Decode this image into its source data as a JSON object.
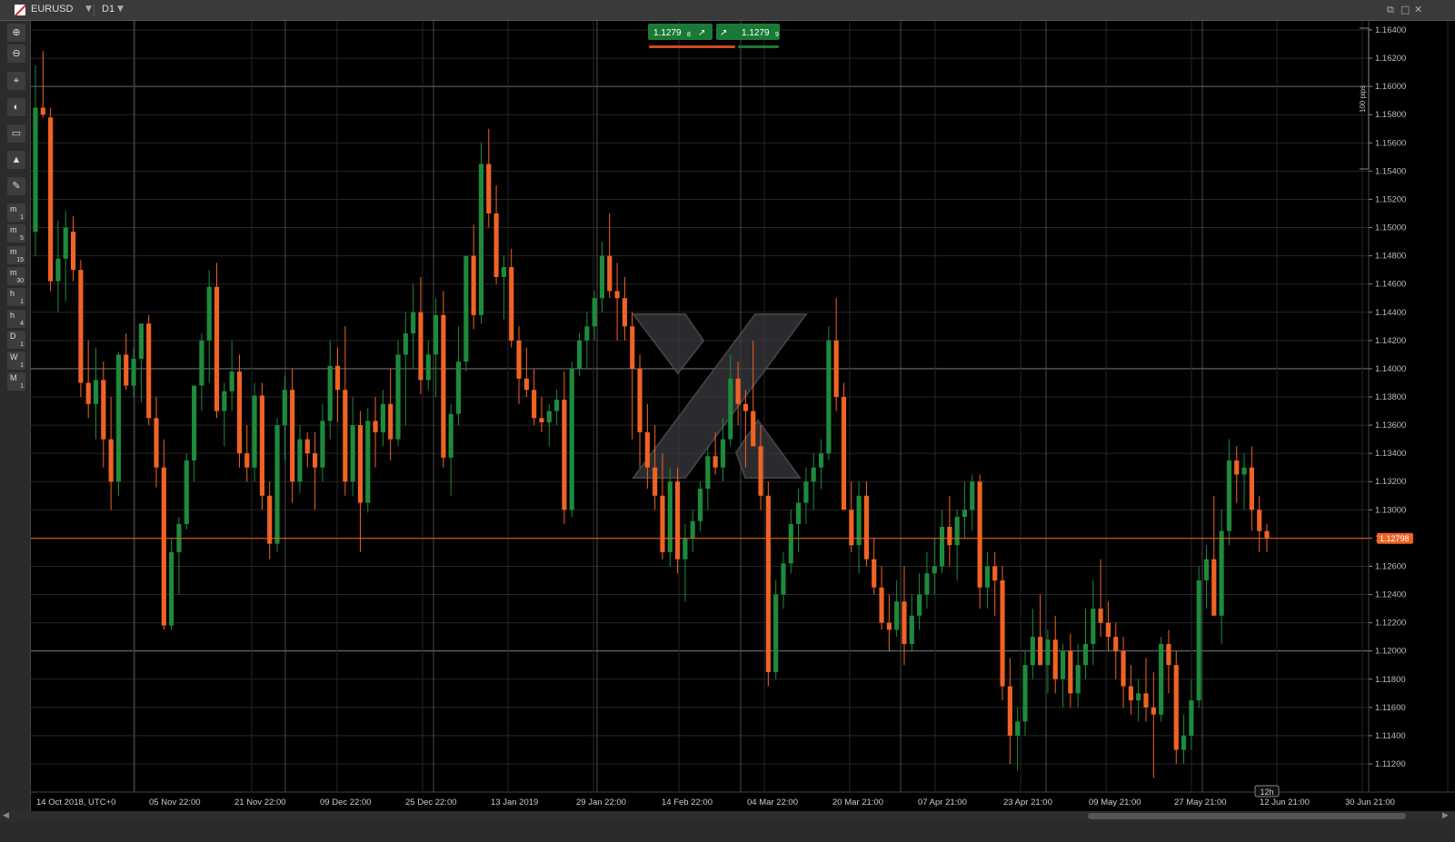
{
  "window": {
    "symbol": "EURUSD",
    "timeframe": "D1",
    "restore_label": "⧉",
    "max_label": "□",
    "close_label": "✕"
  },
  "toolbar": {
    "icons": [
      "zoom-in-icon",
      "zoom-out-icon",
      "crosshair-icon",
      "chart-type-icon",
      "indicator-icon",
      "trader-icon",
      "drawing-icon"
    ],
    "timeframes": [
      {
        "a": "m",
        "b": "1"
      },
      {
        "a": "m",
        "b": "5"
      },
      {
        "a": "m",
        "b": "15"
      },
      {
        "a": "m",
        "b": "30"
      },
      {
        "a": "h",
        "b": "1"
      },
      {
        "a": "h",
        "b": "4"
      },
      {
        "a": "D",
        "b": "1"
      },
      {
        "a": "W",
        "b": "1"
      },
      {
        "a": "M",
        "b": "1"
      }
    ]
  },
  "quote": {
    "sell_price": "1.1279",
    "sell_pip": "8",
    "buy_price": "1.1279",
    "buy_pip": "9"
  },
  "scale_label": "100 pips",
  "current_price_label": "1.12798",
  "period_label": "12h",
  "colors": {
    "bull": "#1d8a3c",
    "bear": "#f06324",
    "background": "#000000",
    "grid": "#2a2a2a",
    "price_line": "#f06324"
  },
  "chart_data": {
    "type": "candlestick",
    "symbol": "EURUSD",
    "timeframe": "D1",
    "ylim": [
      1.111,
      1.165
    ],
    "y_ticks": [
      "1.16400",
      "1.16200",
      "1.16000",
      "1.15800",
      "1.15600",
      "1.15400",
      "1.15200",
      "1.15000",
      "1.14800",
      "1.14600",
      "1.14400",
      "1.14200",
      "1.14000",
      "1.13800",
      "1.13600",
      "1.13400",
      "1.13200",
      "1.13000",
      "1.12800",
      "1.12600",
      "1.12400",
      "1.12200",
      "1.12000",
      "1.11800",
      "1.11600",
      "1.11400",
      "1.11200"
    ],
    "x_ticks": [
      "14 Oct 2018, UTC+0",
      "05 Nov 22:00",
      "21 Nov 22:00",
      "09 Dec 22:00",
      "25 Dec 22:00",
      "13 Jan 2019",
      "29 Jan 22:00",
      "14 Feb 22:00",
      "04 Mar 22:00",
      "20 Mar 21:00",
      "07 Apr 21:00",
      "23 Apr 21:00",
      "09 May 21:00",
      "27 May 21:00",
      "12 Jun 21:00",
      "30 Jun 21:00"
    ],
    "current_price": 1.12798,
    "candles": [
      [
        1.1497,
        1.1615,
        1.148,
        1.1585
      ],
      [
        1.1585,
        1.1625,
        1.1578,
        1.158
      ],
      [
        1.1578,
        1.1585,
        1.1455,
        1.1462
      ],
      [
        1.1462,
        1.1505,
        1.144,
        1.1478
      ],
      [
        1.1478,
        1.1512,
        1.1448,
        1.15
      ],
      [
        1.1497,
        1.1508,
        1.1462,
        1.147
      ],
      [
        1.147,
        1.1477,
        1.138,
        1.139
      ],
      [
        1.139,
        1.142,
        1.1365,
        1.1375
      ],
      [
        1.1375,
        1.1415,
        1.135,
        1.1392
      ],
      [
        1.1392,
        1.1405,
        1.133,
        1.135
      ],
      [
        1.135,
        1.138,
        1.13,
        1.132
      ],
      [
        1.132,
        1.1412,
        1.131,
        1.141
      ],
      [
        1.141,
        1.1425,
        1.1385,
        1.1388
      ],
      [
        1.1388,
        1.1415,
        1.138,
        1.1407
      ],
      [
        1.1407,
        1.143,
        1.1376,
        1.1432
      ],
      [
        1.1432,
        1.1438,
        1.136,
        1.1365
      ],
      [
        1.1365,
        1.138,
        1.1316,
        1.133
      ],
      [
        1.133,
        1.135,
        1.1215,
        1.1218
      ],
      [
        1.1218,
        1.128,
        1.1215,
        1.127
      ],
      [
        1.127,
        1.1295,
        1.124,
        1.129
      ],
      [
        1.129,
        1.134,
        1.1286,
        1.1335
      ],
      [
        1.1335,
        1.137,
        1.132,
        1.1388
      ],
      [
        1.1388,
        1.1425,
        1.137,
        1.142
      ],
      [
        1.142,
        1.147,
        1.139,
        1.1458
      ],
      [
        1.1458,
        1.1475,
        1.1365,
        1.137
      ],
      [
        1.137,
        1.139,
        1.1345,
        1.1384
      ],
      [
        1.1384,
        1.142,
        1.137,
        1.1398
      ],
      [
        1.1398,
        1.141,
        1.133,
        1.134
      ],
      [
        1.134,
        1.136,
        1.132,
        1.133
      ],
      [
        1.133,
        1.139,
        1.132,
        1.1381
      ],
      [
        1.1381,
        1.139,
        1.13,
        1.131
      ],
      [
        1.131,
        1.132,
        1.1265,
        1.1276
      ],
      [
        1.1276,
        1.1365,
        1.127,
        1.136
      ],
      [
        1.136,
        1.1395,
        1.1335,
        1.1385
      ],
      [
        1.1385,
        1.14,
        1.1305,
        1.132
      ],
      [
        1.132,
        1.136,
        1.1312,
        1.135
      ],
      [
        1.135,
        1.1355,
        1.133,
        1.134
      ],
      [
        1.134,
        1.1355,
        1.13,
        1.133
      ],
      [
        1.133,
        1.1375,
        1.132,
        1.1363
      ],
      [
        1.1363,
        1.142,
        1.135,
        1.1402
      ],
      [
        1.1402,
        1.1415,
        1.1362,
        1.1385
      ],
      [
        1.1385,
        1.143,
        1.131,
        1.132
      ],
      [
        1.132,
        1.138,
        1.131,
        1.136
      ],
      [
        1.136,
        1.137,
        1.127,
        1.1305
      ],
      [
        1.1305,
        1.1372,
        1.1298,
        1.1363
      ],
      [
        1.1363,
        1.138,
        1.133,
        1.1355
      ],
      [
        1.1355,
        1.1385,
        1.1345,
        1.1375
      ],
      [
        1.1375,
        1.14,
        1.1335,
        1.135
      ],
      [
        1.135,
        1.142,
        1.1345,
        1.141
      ],
      [
        1.141,
        1.144,
        1.136,
        1.1425
      ],
      [
        1.1425,
        1.146,
        1.14,
        1.144
      ],
      [
        1.144,
        1.1465,
        1.1382,
        1.1392
      ],
      [
        1.1392,
        1.142,
        1.1385,
        1.141
      ],
      [
        1.141,
        1.145,
        1.138,
        1.1438
      ],
      [
        1.1438,
        1.1455,
        1.133,
        1.1337
      ],
      [
        1.1337,
        1.1375,
        1.131,
        1.1368
      ],
      [
        1.1368,
        1.143,
        1.136,
        1.1405
      ],
      [
        1.1405,
        1.148,
        1.1398,
        1.148
      ],
      [
        1.148,
        1.1502,
        1.1428,
        1.1438
      ],
      [
        1.1438,
        1.156,
        1.1432,
        1.1545
      ],
      [
        1.1545,
        1.157,
        1.15,
        1.151
      ],
      [
        1.151,
        1.153,
        1.146,
        1.1465
      ],
      [
        1.1465,
        1.148,
        1.1435,
        1.1472
      ],
      [
        1.1472,
        1.1485,
        1.1415,
        1.142
      ],
      [
        1.142,
        1.143,
        1.1375,
        1.1393
      ],
      [
        1.1393,
        1.1415,
        1.138,
        1.1385
      ],
      [
        1.1385,
        1.14,
        1.136,
        1.1365
      ],
      [
        1.1365,
        1.138,
        1.1355,
        1.1362
      ],
      [
        1.1362,
        1.1375,
        1.1345,
        1.137
      ],
      [
        1.137,
        1.1385,
        1.136,
        1.1378
      ],
      [
        1.1378,
        1.1398,
        1.129,
        1.13
      ],
      [
        1.13,
        1.1405,
        1.1295,
        1.14
      ],
      [
        1.14,
        1.1425,
        1.1395,
        1.142
      ],
      [
        1.142,
        1.144,
        1.14,
        1.143
      ],
      [
        1.143,
        1.1455,
        1.142,
        1.145
      ],
      [
        1.145,
        1.149,
        1.144,
        1.148
      ],
      [
        1.148,
        1.151,
        1.145,
        1.1455
      ],
      [
        1.1455,
        1.1475,
        1.142,
        1.145
      ],
      [
        1.145,
        1.1465,
        1.142,
        1.143
      ],
      [
        1.143,
        1.144,
        1.135,
        1.14
      ],
      [
        1.14,
        1.141,
        1.133,
        1.1355
      ],
      [
        1.1355,
        1.1375,
        1.1315,
        1.133
      ],
      [
        1.133,
        1.136,
        1.13,
        1.131
      ],
      [
        1.131,
        1.134,
        1.1265,
        1.127
      ],
      [
        1.127,
        1.133,
        1.126,
        1.132
      ],
      [
        1.132,
        1.133,
        1.1255,
        1.1265
      ],
      [
        1.1265,
        1.129,
        1.1235,
        1.128
      ],
      [
        1.128,
        1.13,
        1.127,
        1.1292
      ],
      [
        1.1292,
        1.132,
        1.1285,
        1.1315
      ],
      [
        1.1315,
        1.1345,
        1.13,
        1.1338
      ],
      [
        1.1338,
        1.1355,
        1.1325,
        1.133
      ],
      [
        1.133,
        1.1365,
        1.132,
        1.135
      ],
      [
        1.135,
        1.141,
        1.1345,
        1.1393
      ],
      [
        1.1393,
        1.1405,
        1.136,
        1.1375
      ],
      [
        1.1375,
        1.1385,
        1.133,
        1.137
      ],
      [
        1.137,
        1.142,
        1.1345,
        1.1345
      ],
      [
        1.1345,
        1.136,
        1.13,
        1.131
      ],
      [
        1.131,
        1.132,
        1.1175,
        1.1185
      ],
      [
        1.1185,
        1.125,
        1.118,
        1.124
      ],
      [
        1.124,
        1.127,
        1.123,
        1.1262
      ],
      [
        1.1262,
        1.13,
        1.1255,
        1.129
      ],
      [
        1.129,
        1.1315,
        1.127,
        1.1305
      ],
      [
        1.1305,
        1.133,
        1.129,
        1.132
      ],
      [
        1.132,
        1.134,
        1.13,
        1.133
      ],
      [
        1.133,
        1.135,
        1.1315,
        1.134
      ],
      [
        1.134,
        1.143,
        1.1335,
        1.142
      ],
      [
        1.142,
        1.145,
        1.137,
        1.138
      ],
      [
        1.138,
        1.139,
        1.132,
        1.13
      ],
      [
        1.13,
        1.132,
        1.127,
        1.1275
      ],
      [
        1.1275,
        1.132,
        1.1255,
        1.131
      ],
      [
        1.131,
        1.132,
        1.126,
        1.1265
      ],
      [
        1.1265,
        1.128,
        1.124,
        1.1245
      ],
      [
        1.1245,
        1.126,
        1.1215,
        1.122
      ],
      [
        1.122,
        1.124,
        1.12,
        1.1215
      ],
      [
        1.1215,
        1.125,
        1.121,
        1.1235
      ],
      [
        1.1235,
        1.126,
        1.119,
        1.1205
      ],
      [
        1.1205,
        1.124,
        1.12,
        1.1225
      ],
      [
        1.1225,
        1.1255,
        1.1215,
        1.124
      ],
      [
        1.124,
        1.127,
        1.123,
        1.1255
      ],
      [
        1.1255,
        1.128,
        1.124,
        1.126
      ],
      [
        1.126,
        1.13,
        1.1255,
        1.1288
      ],
      [
        1.1288,
        1.131,
        1.126,
        1.1275
      ],
      [
        1.1275,
        1.13,
        1.125,
        1.1295
      ],
      [
        1.1295,
        1.132,
        1.128,
        1.13
      ],
      [
        1.13,
        1.1325,
        1.1285,
        1.132
      ],
      [
        1.132,
        1.1325,
        1.123,
        1.1245
      ],
      [
        1.1245,
        1.127,
        1.123,
        1.126
      ],
      [
        1.126,
        1.127,
        1.1225,
        1.125
      ],
      [
        1.125,
        1.126,
        1.1165,
        1.1175
      ],
      [
        1.1175,
        1.1195,
        1.112,
        1.114
      ],
      [
        1.114,
        1.116,
        1.1115,
        1.115
      ],
      [
        1.115,
        1.12,
        1.114,
        1.119
      ],
      [
        1.119,
        1.123,
        1.118,
        1.121
      ],
      [
        1.121,
        1.124,
        1.119,
        1.119
      ],
      [
        1.119,
        1.1215,
        1.117,
        1.1208
      ],
      [
        1.1208,
        1.1225,
        1.117,
        1.118
      ],
      [
        1.118,
        1.1205,
        1.116,
        1.12
      ],
      [
        1.12,
        1.1212,
        1.116,
        1.117
      ],
      [
        1.117,
        1.1205,
        1.116,
        1.119
      ],
      [
        1.119,
        1.123,
        1.118,
        1.1205
      ],
      [
        1.1205,
        1.125,
        1.119,
        1.123
      ],
      [
        1.123,
        1.1265,
        1.121,
        1.122
      ],
      [
        1.122,
        1.1235,
        1.12,
        1.121
      ],
      [
        1.121,
        1.122,
        1.118,
        1.12
      ],
      [
        1.12,
        1.121,
        1.116,
        1.1175
      ],
      [
        1.1175,
        1.119,
        1.1155,
        1.1165
      ],
      [
        1.1165,
        1.118,
        1.115,
        1.117
      ],
      [
        1.117,
        1.1195,
        1.115,
        1.116
      ],
      [
        1.116,
        1.1185,
        1.111,
        1.1155
      ],
      [
        1.1155,
        1.121,
        1.115,
        1.1205
      ],
      [
        1.1205,
        1.1215,
        1.117,
        1.119
      ],
      [
        1.119,
        1.12,
        1.112,
        1.113
      ],
      [
        1.113,
        1.1155,
        1.112,
        1.114
      ],
      [
        1.114,
        1.118,
        1.113,
        1.1165
      ],
      [
        1.1165,
        1.126,
        1.116,
        1.125
      ],
      [
        1.125,
        1.1275,
        1.123,
        1.1265
      ],
      [
        1.1265,
        1.131,
        1.124,
        1.1225
      ],
      [
        1.1225,
        1.13,
        1.1205,
        1.1285
      ],
      [
        1.1285,
        1.135,
        1.1275,
        1.1335
      ],
      [
        1.1335,
        1.1345,
        1.1305,
        1.1325
      ],
      [
        1.1325,
        1.134,
        1.13,
        1.133
      ],
      [
        1.133,
        1.1345,
        1.1285,
        1.13
      ],
      [
        1.13,
        1.131,
        1.127,
        1.1285
      ],
      [
        1.1285,
        1.129,
        1.127,
        1.128
      ]
    ]
  }
}
